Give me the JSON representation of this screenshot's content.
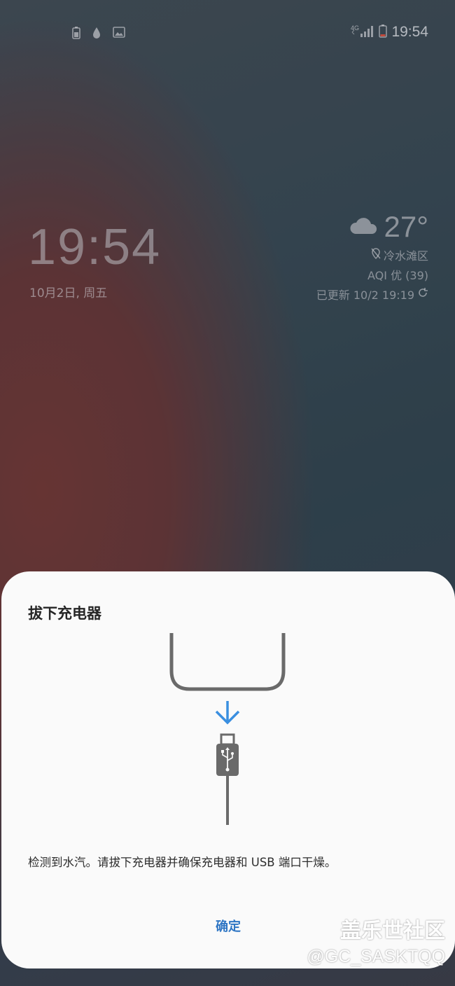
{
  "status_bar": {
    "time": "19:54",
    "network": "4G",
    "icons_left": [
      "battery-saver-icon",
      "water-drop-icon",
      "gallery-icon"
    ],
    "icons_right": [
      "signal-icon",
      "battery-low-icon"
    ]
  },
  "lock_screen": {
    "clock": "19:54",
    "date": "10月2日, 周五",
    "weather": {
      "temperature": "27°",
      "icon": "cloud-icon",
      "location": "冷水滩区",
      "aqi": "AQI 优 (39)",
      "updated": "已更新 10/2 19:19"
    }
  },
  "dialog": {
    "title": "拔下充电器",
    "message": "检测到水汽。请拔下充电器并确保充电器和 USB 端口干燥。",
    "ok_label": "确定",
    "accent_color": "#2f76c4",
    "arrow_color": "#3a8fe0",
    "illustration": [
      "phone-bottom-icon",
      "arrow-down-icon",
      "usb-plug-icon"
    ]
  },
  "watermark": {
    "title": "盖乐世社区",
    "id": "@GC_SASKTQQ"
  }
}
